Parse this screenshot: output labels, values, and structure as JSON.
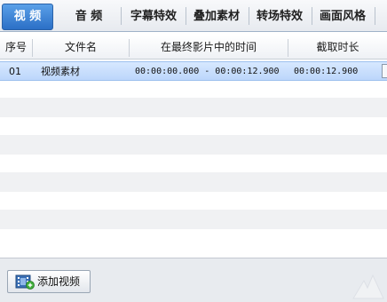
{
  "tabs": [
    {
      "label": "视 频",
      "active": true
    },
    {
      "label": "音 频",
      "active": false
    },
    {
      "label": "字幕特效",
      "active": false
    },
    {
      "label": "叠加素材",
      "active": false
    },
    {
      "label": "转场特效",
      "active": false
    },
    {
      "label": "画面风格",
      "active": false
    }
  ],
  "table": {
    "headers": [
      "序号",
      "文件名",
      "在最终影片中的时间",
      "截取时长"
    ],
    "rows": [
      {
        "index": "01",
        "filename": "视频素材",
        "time_range": "00:00:00.000 - 00:00:12.900",
        "duration": "00:00:12.900",
        "selected": true
      }
    ]
  },
  "bottom": {
    "add_video_label": "添加视频"
  },
  "colors": {
    "tab_active": "#2b6fc6",
    "row_selected": "#c8defc",
    "row_stripe": "#f0f1f3"
  }
}
